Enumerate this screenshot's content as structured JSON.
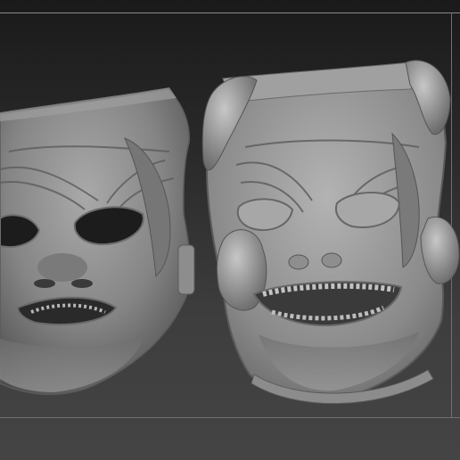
{
  "scene": {
    "subject": "",
    "background_color_top": "#1a1a1a",
    "background_color_bottom": "#444444",
    "material_color": "#8c8c8c"
  },
  "objects": [
    {
      "name": "left-mask",
      "variant": "base"
    },
    {
      "name": "right-mask",
      "variant": "with-teeth-and-rim"
    }
  ]
}
